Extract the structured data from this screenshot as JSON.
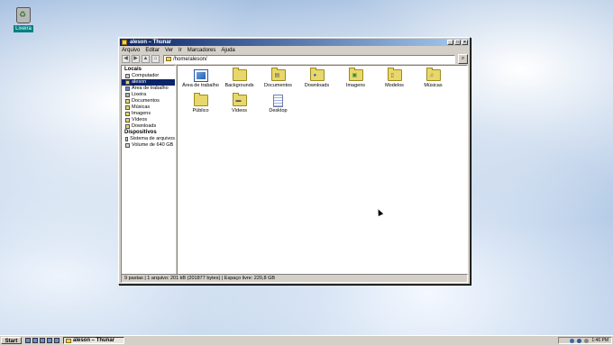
{
  "desktop": {
    "recycle_bin_label": "Lixeira"
  },
  "window": {
    "title": "aleson – Thunar",
    "menu": [
      "Arquivo",
      "Editar",
      "Ver",
      "Ir",
      "Marcadores",
      "Ajuda"
    ],
    "address": "/home/aleson/"
  },
  "sidebar": {
    "locais_header": "Locais",
    "locais": [
      {
        "label": "Computador",
        "icon": "computer-icon",
        "selected": false
      },
      {
        "label": "aleson",
        "icon": "home-icon",
        "selected": true
      },
      {
        "label": "Área de trabalho",
        "icon": "desktop-icon",
        "selected": false
      },
      {
        "label": "Lixeira",
        "icon": "trash-icon",
        "selected": false
      },
      {
        "label": "Documentos",
        "icon": "folder-icon",
        "selected": false
      },
      {
        "label": "Músicas",
        "icon": "folder-icon",
        "selected": false
      },
      {
        "label": "Imagens",
        "icon": "folder-icon",
        "selected": false
      },
      {
        "label": "Vídeos",
        "icon": "folder-icon",
        "selected": false
      },
      {
        "label": "Downloads",
        "icon": "folder-icon",
        "selected": false
      }
    ],
    "devices_header": "Dispositivos",
    "devices": [
      {
        "label": "Sistema de arquivos",
        "icon": "drive-icon"
      },
      {
        "label": "Volume de 640 GB",
        "icon": "drive-icon"
      }
    ]
  },
  "files": [
    {
      "label": "Área de trabalho",
      "type": "desktop"
    },
    {
      "label": "Backgrounds",
      "type": "folder"
    },
    {
      "label": "Documentos",
      "type": "folder"
    },
    {
      "label": "Downloads",
      "type": "folder"
    },
    {
      "label": "Imagens",
      "type": "folder"
    },
    {
      "label": "Modelos",
      "type": "folder"
    },
    {
      "label": "Músicas",
      "type": "folder"
    },
    {
      "label": "Público",
      "type": "folder"
    },
    {
      "label": "Vídeos",
      "type": "folder"
    },
    {
      "label": "Desktop",
      "type": "document"
    }
  ],
  "statusbar": {
    "text": "9 pastas | 1 arquivo: 201 kB (201877 bytes) | Espaço livre: 220,8 GB"
  },
  "taskbar": {
    "start_label": "Start",
    "task_label": "aleson – Thunar",
    "clock": "1:46 PM"
  },
  "colors": {
    "titlebar": "#0a246a",
    "selection": "#0a246a",
    "desktop_sky": "#a9c3e3"
  }
}
